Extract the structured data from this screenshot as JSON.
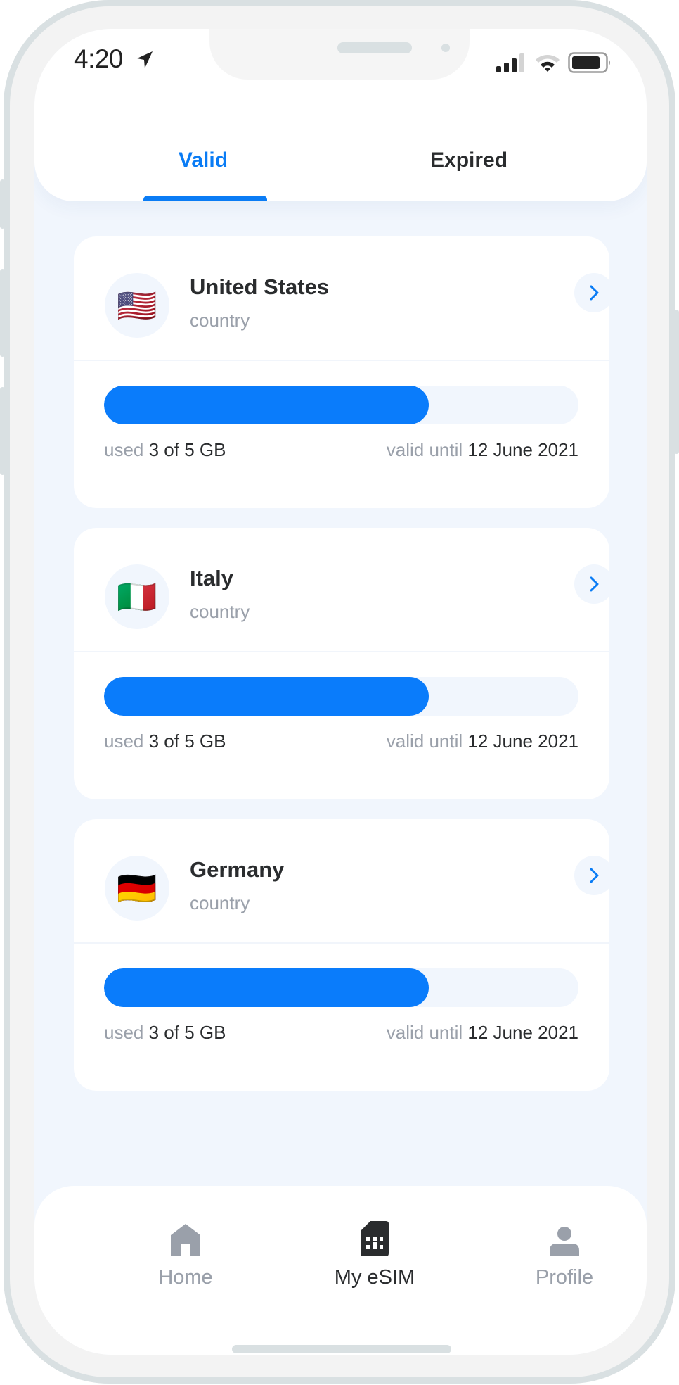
{
  "status_bar": {
    "time": "4:20",
    "location_icon": "location-arrow-icon",
    "signal_bars": 3,
    "signal_max": 4,
    "wifi_level": 2,
    "battery_level": 0.85
  },
  "tabs": [
    {
      "label": "Valid",
      "active": true
    },
    {
      "label": "Expired",
      "active": false
    }
  ],
  "colors": {
    "accent": "#0a7cf5",
    "text_primary": "#2a2c2e",
    "text_muted": "#9aa0aa",
    "background": "#f1f6fd"
  },
  "esims": [
    {
      "country": "United States",
      "type": "country",
      "flag": "🇺🇸",
      "progress_percent": 65,
      "progress_label": "65%",
      "used_label": "used",
      "used_value": "3 of 5 GB",
      "valid_label": "valid until",
      "valid_value": "12 June 2021"
    },
    {
      "country": "Italy",
      "type": "country",
      "flag": "🇮🇹",
      "progress_percent": 65,
      "progress_label": "65%",
      "used_label": "used",
      "used_value": "3 of 5 GB",
      "valid_label": "valid until",
      "valid_value": "12 June 2021"
    },
    {
      "country": "Germany",
      "type": "country",
      "flag": "🇩🇪",
      "progress_percent": 65,
      "progress_label": "65%",
      "used_label": "used",
      "used_value": "3 of 5 GB",
      "valid_label": "valid until",
      "valid_value": "12 June 2021"
    }
  ],
  "bottom_nav": [
    {
      "label": "Home",
      "icon": "home-icon",
      "active": false
    },
    {
      "label": "My eSIM",
      "icon": "sim-card-icon",
      "active": true
    },
    {
      "label": "Profile",
      "icon": "user-icon",
      "active": false
    }
  ]
}
